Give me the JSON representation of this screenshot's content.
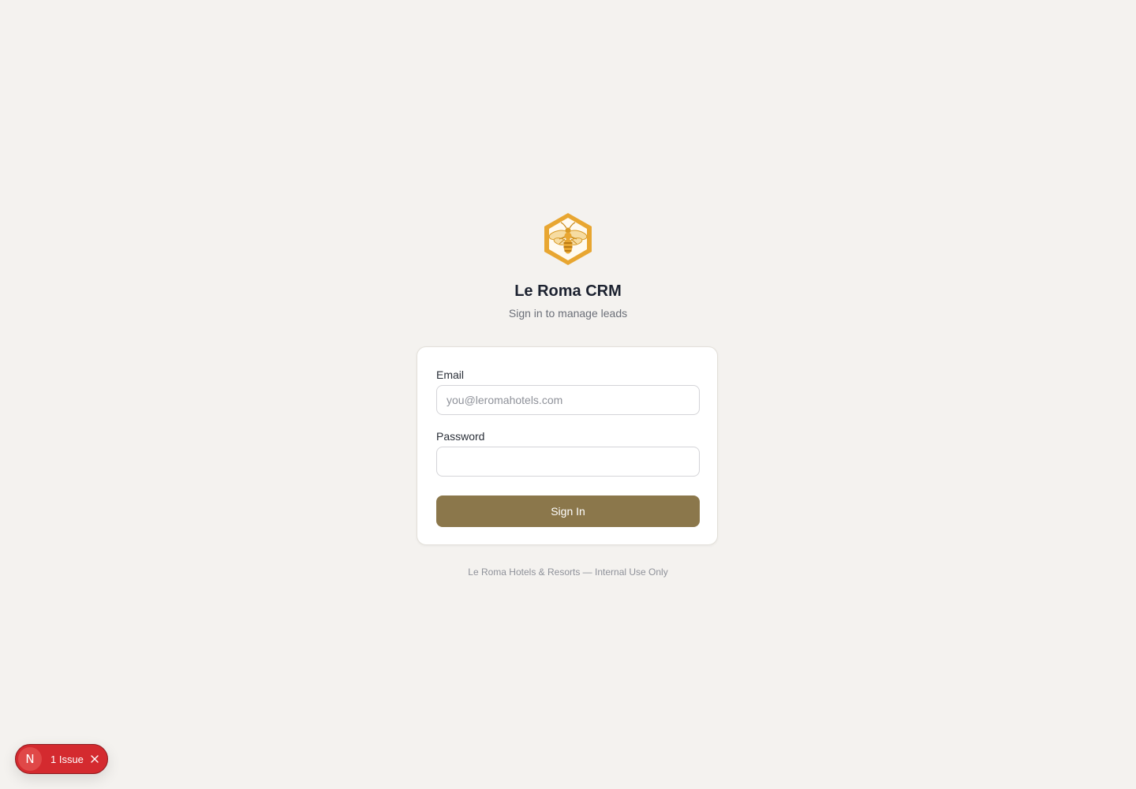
{
  "app": {
    "title": "Le Roma CRM",
    "subtitle": "Sign in to manage leads",
    "logo_icon": "honeybee-hexagon-icon",
    "brand_color": "#E8A631"
  },
  "form": {
    "email_label": "Email",
    "email_placeholder": "you@leromahotels.com",
    "email_value": "",
    "password_label": "Password",
    "password_value": "",
    "submit_label": "Sign In",
    "submit_color": "#8B774B"
  },
  "footer": {
    "text": "Le Roma Hotels & Resorts — Internal Use Only"
  },
  "dev_overlay": {
    "badge_letter": "N",
    "issue_label": "1 Issue",
    "color": "#D42A2F"
  }
}
